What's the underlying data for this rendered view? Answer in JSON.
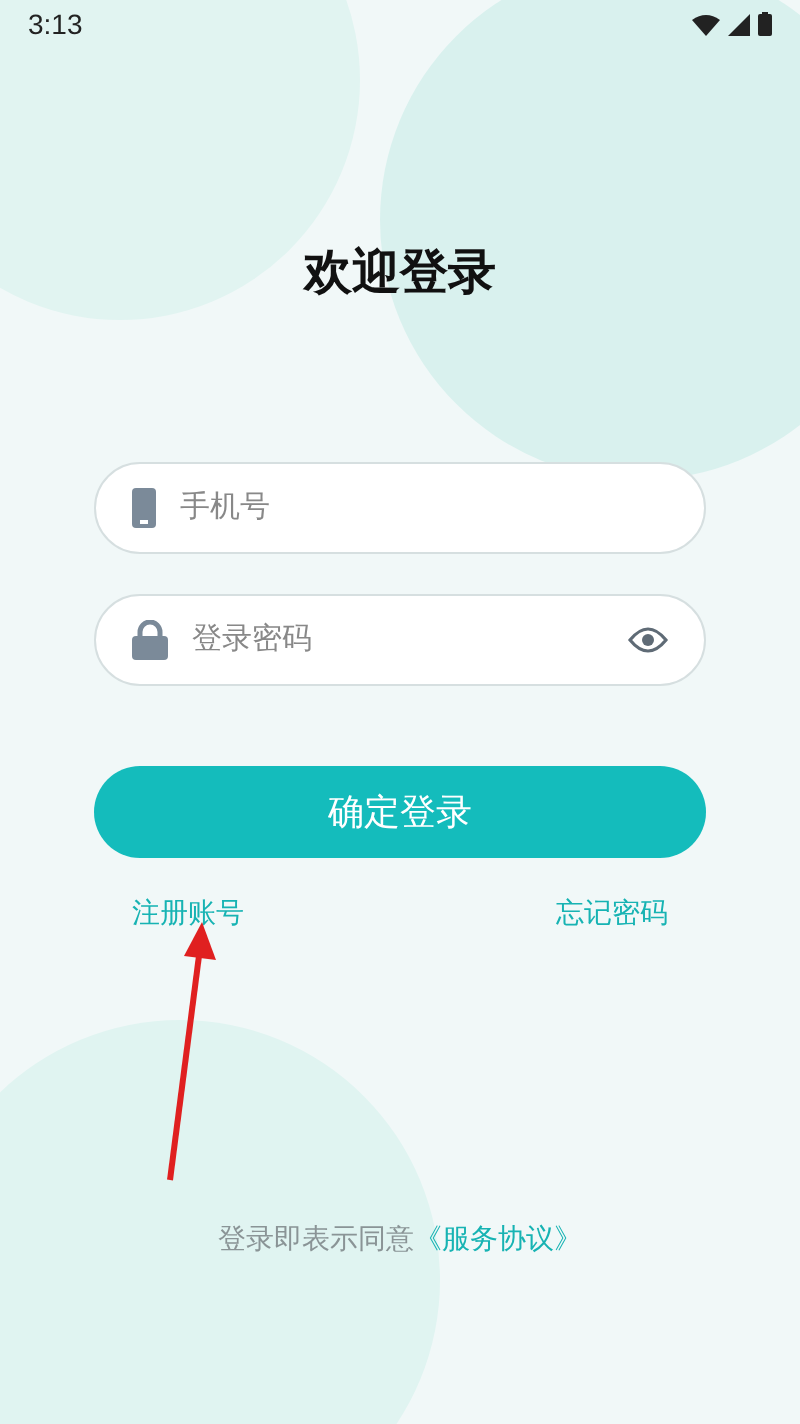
{
  "status_bar": {
    "time": "3:13"
  },
  "title": "欢迎登录",
  "fields": [
    {
      "kind": "phone",
      "placeholder": "手机号"
    },
    {
      "kind": "password",
      "placeholder": "登录密码"
    }
  ],
  "login_button": "确定登录",
  "links": [
    {
      "label": "注册账号"
    },
    {
      "label": "忘记密码"
    }
  ],
  "agreement": {
    "text": "登录即表示同意",
    "link": "《服务协议》"
  }
}
